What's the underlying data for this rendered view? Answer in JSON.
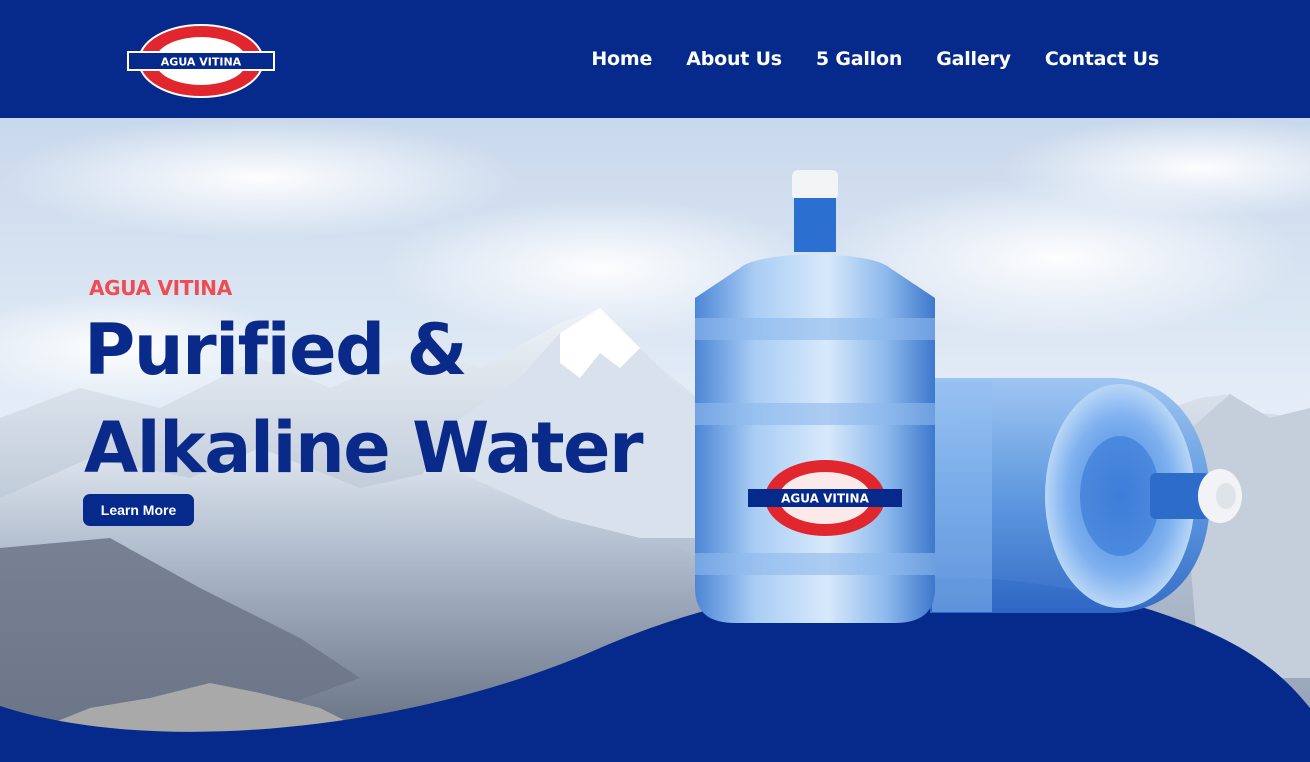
{
  "brand": {
    "logo_text": "AGUA VITINA",
    "colors": {
      "navy": "#062a8c",
      "red": "#e1262d",
      "white": "#ffffff",
      "coral": "#ef4b52"
    }
  },
  "nav": {
    "items": [
      {
        "label": "Home"
      },
      {
        "label": "About Us"
      },
      {
        "label": "5 Gallon"
      },
      {
        "label": "Gallery"
      },
      {
        "label": "Contact Us"
      }
    ]
  },
  "hero": {
    "kicker": "AGUA VITINA",
    "headline_line1": "Purified &",
    "headline_line2": "Alkaline Water",
    "cta_label": "Learn More",
    "bottle_label": "AGUA VITINA",
    "background": "snowy-mountains-photo"
  }
}
